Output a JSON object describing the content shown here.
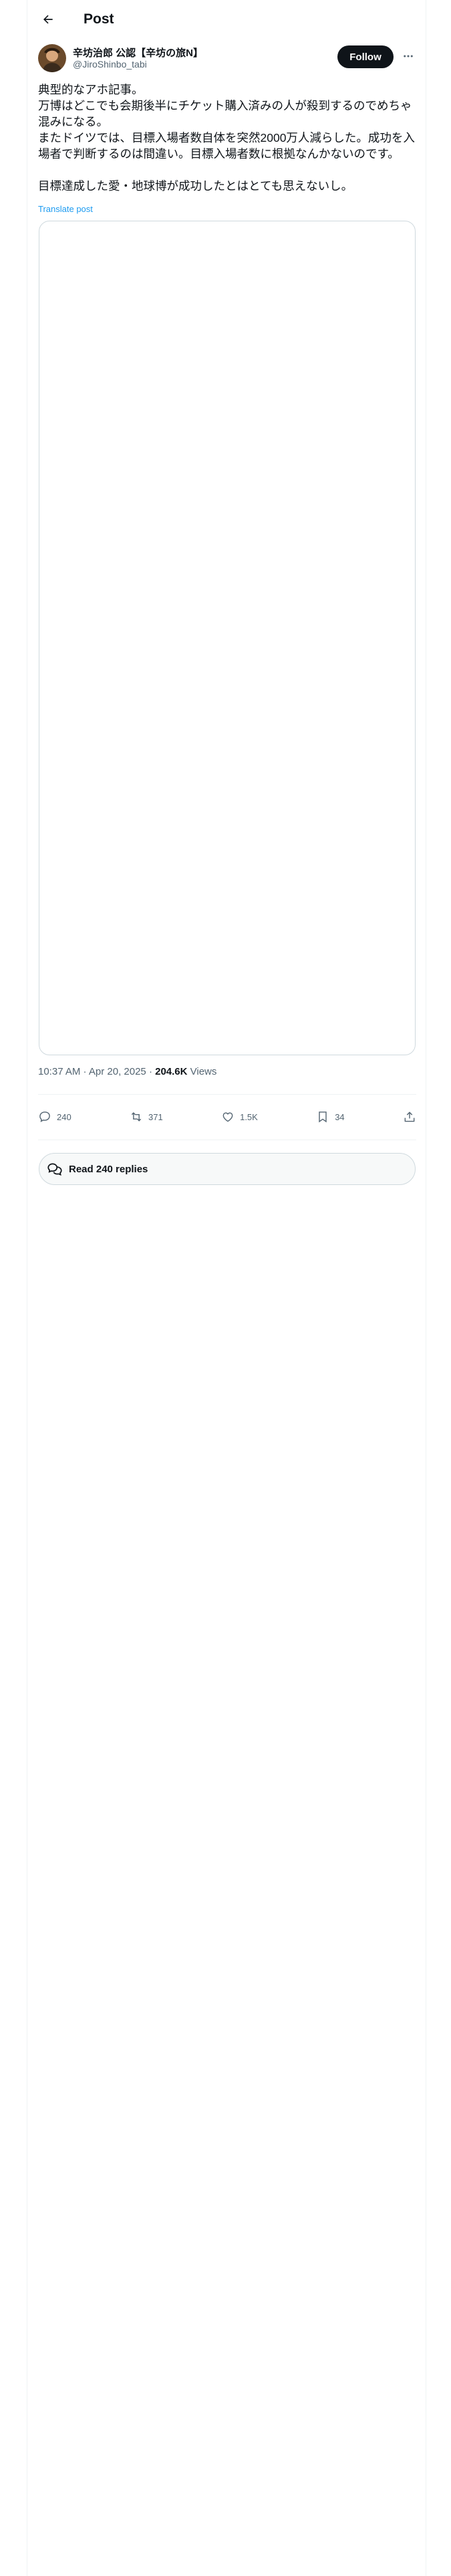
{
  "header": {
    "title": "Post"
  },
  "author": {
    "name": "辛坊治郎 公認【辛坊の旅N】",
    "handle": "@JiroShinbo_tabi",
    "follow_label": "Follow"
  },
  "post": {
    "lines": [
      "典型的なアホ記事。",
      "万博はどこでも会期後半にチケット購入済みの人が殺到するのでめちゃ混みになる。",
      "またドイツでは、目標入場者数自体を突然2000万人減らした。成功を入場者で判断するのは間違い。目標入場者数に根拠なんかないのです。",
      "目標達成した愛・地球博が成功したとはとても思えないし。"
    ],
    "translate_label": "Translate post",
    "time": "10:37 AM · Apr 20, 2025 · ",
    "views_count": "204.6K",
    "views_label": " Views"
  },
  "actions": {
    "replies": "240",
    "reposts": "371",
    "likes": "1.5K",
    "bookmarks": "34"
  },
  "read_replies_label": "Read 240 replies",
  "icons": [
    "back-arrow-icon",
    "more-icon",
    "reply-icon",
    "repost-icon",
    "like-icon",
    "bookmark-icon",
    "share-icon",
    "replies-bubble-icon"
  ],
  "colors": {
    "accent": "#1d9bf0",
    "text": "#0f1419",
    "secondary": "#536471",
    "border": "#cfd9de"
  }
}
